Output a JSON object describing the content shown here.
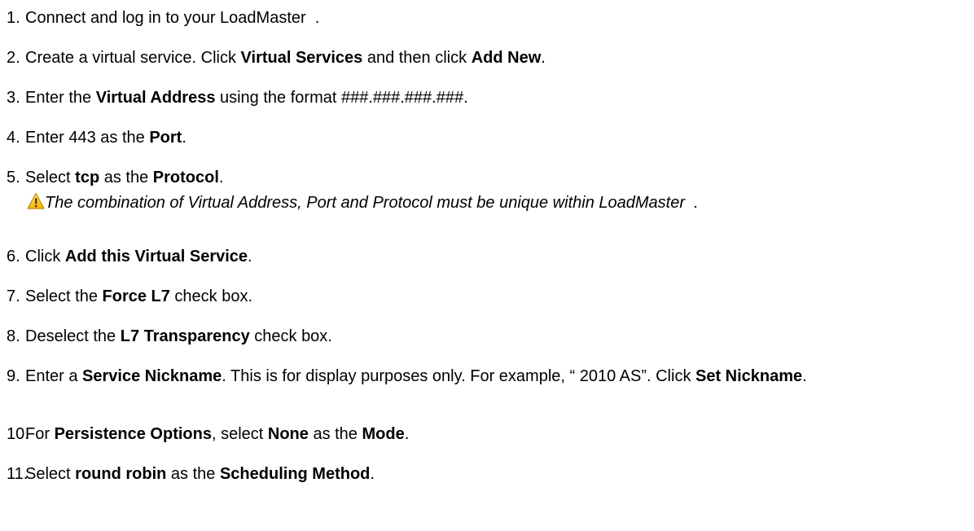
{
  "steps": [
    {
      "num": "1.",
      "parts": [
        {
          "t": "Connect and log in to your LoadMaster  .",
          "b": false
        }
      ]
    },
    {
      "num": "2.",
      "parts": [
        {
          "t": "Create a virtual service. Click ",
          "b": false
        },
        {
          "t": "Virtual Services",
          "b": true
        },
        {
          "t": " and then click ",
          "b": false
        },
        {
          "t": "Add New",
          "b": true
        },
        {
          "t": ".",
          "b": false
        }
      ]
    },
    {
      "num": "3.",
      "parts": [
        {
          "t": "Enter the ",
          "b": false
        },
        {
          "t": "Virtual Address",
          "b": true
        },
        {
          "t": " using the format ###.###.###.###.",
          "b": false
        }
      ]
    },
    {
      "num": "4.",
      "parts": [
        {
          "t": "Enter 443 as the ",
          "b": false
        },
        {
          "t": "Port",
          "b": true
        },
        {
          "t": ".",
          "b": false
        }
      ]
    },
    {
      "num": "5.",
      "parts": [
        {
          "t": "Select ",
          "b": false
        },
        {
          "t": "tcp",
          "b": true
        },
        {
          "t": " as the ",
          "b": false
        },
        {
          "t": "Protocol",
          "b": true
        },
        {
          "t": ".",
          "b": false
        }
      ],
      "note": "The combination of Virtual Address, Port and Protocol must be unique within LoadMaster  ."
    },
    {
      "num": "6.",
      "parts": [
        {
          "t": "Click ",
          "b": false
        },
        {
          "t": "Add this Virtual Service",
          "b": true
        },
        {
          "t": ".",
          "b": false
        }
      ]
    },
    {
      "num": "7.",
      "parts": [
        {
          "t": "Select the ",
          "b": false
        },
        {
          "t": "Force L7",
          "b": true
        },
        {
          "t": " check box.",
          "b": false
        }
      ]
    },
    {
      "num": "8.",
      "parts": [
        {
          "t": "Deselect the ",
          "b": false
        },
        {
          "t": "L7 Transparency",
          "b": true
        },
        {
          "t": " check box.",
          "b": false
        }
      ]
    },
    {
      "num": "9.",
      "parts": [
        {
          "t": "Enter a ",
          "b": false
        },
        {
          "t": "Service Nickname",
          "b": true
        },
        {
          "t": ". This is for display purposes only. For example, “ 2010 AS”. Click ",
          "b": false
        },
        {
          "t": "Set Nickname",
          "b": true
        },
        {
          "t": ".",
          "b": false
        }
      ]
    },
    {
      "num": "10.",
      "parts": [
        {
          "t": "For ",
          "b": false
        },
        {
          "t": "Persistence Options",
          "b": true
        },
        {
          "t": ", select ",
          "b": false
        },
        {
          "t": "None",
          "b": true
        },
        {
          "t": " as the ",
          "b": false
        },
        {
          "t": "Mode",
          "b": true
        },
        {
          "t": ".",
          "b": false
        }
      ]
    },
    {
      "num": "11.",
      "parts": [
        {
          "t": "Select ",
          "b": false
        },
        {
          "t": "round robin",
          "b": true
        },
        {
          "t": " as the ",
          "b": false
        },
        {
          "t": "Scheduling Method",
          "b": true
        },
        {
          "t": ".",
          "b": false
        }
      ]
    }
  ],
  "icons": {
    "warning": "warning-icon"
  },
  "colors": {
    "warning_fill": "#F5C400",
    "warning_outline": "#C08A00"
  }
}
